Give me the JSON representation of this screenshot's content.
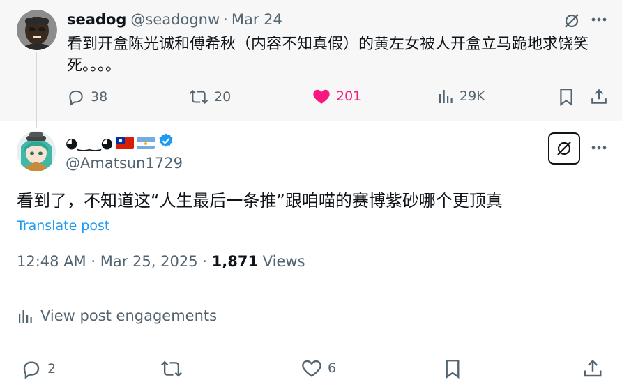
{
  "parent": {
    "name": "seadog",
    "handle": "@seadognw",
    "separator": "·",
    "date": "Mar 24",
    "text": "看到开盒陈光诚和傅希秋（内容不知真假）的黄左女被人开盒立马跪地求饶笑死。。。。",
    "replies": "38",
    "retweets": "20",
    "likes": "201",
    "views": "29K",
    "like_color": "#f91880"
  },
  "main": {
    "display_name": "◕‿‿◕",
    "flags": [
      "taiwan-flag",
      "argentina-flag"
    ],
    "verified": true,
    "handle": "@Amatsun1729",
    "text": "看到了，不知道这“人生最后一条推”跟咱喵的赛博紫砂哪个更顶真",
    "translate_label": "Translate post",
    "time": "12:48 AM",
    "separator": "·",
    "date": "Mar 25, 2025",
    "views_count": "1,871",
    "views_label": "Views",
    "engagements_label": "View post engagements",
    "replies": "2",
    "retweets": "",
    "likes": "6"
  },
  "colors": {
    "text": "#0f1419",
    "secondary": "#536471",
    "link": "#1d9bf0",
    "verified": "#1d9bf0",
    "parent_bg": "#f7f7f7",
    "divider": "#eff3f4"
  }
}
